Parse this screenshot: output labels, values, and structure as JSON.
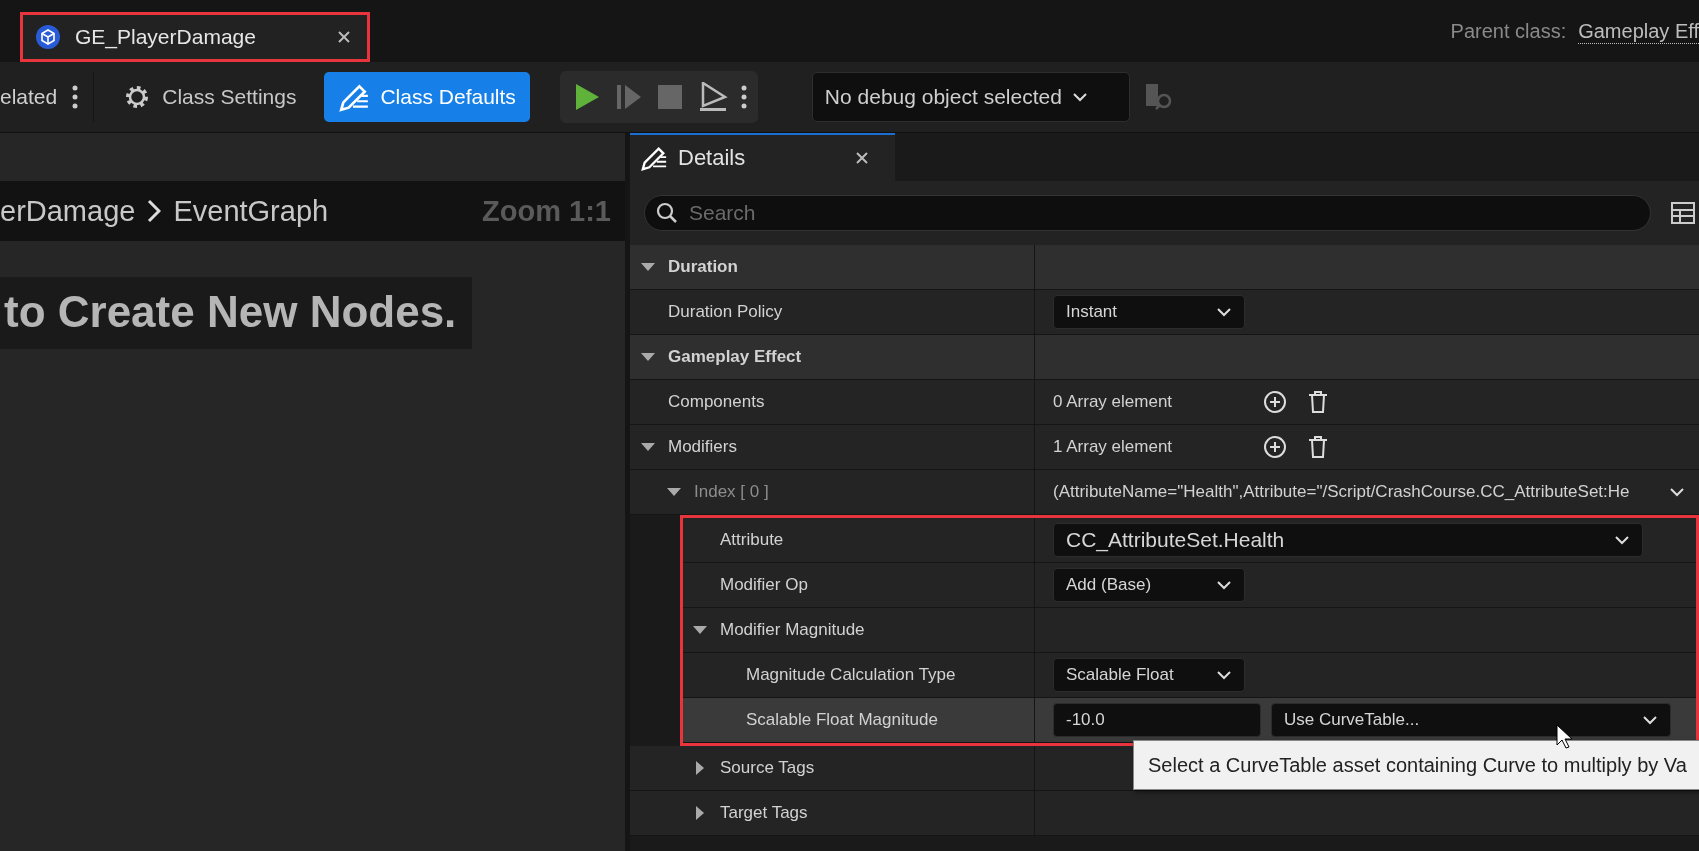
{
  "document_tab": {
    "title": "GE_PlayerDamage",
    "highlighted": true
  },
  "parent_class": {
    "label": "Parent class:",
    "value": "Gameplay Eff"
  },
  "toolbar": {
    "related_label": "elated",
    "buttons": [
      {
        "label": "Class Settings",
        "kind": "settings",
        "selected": false
      },
      {
        "label": "Class Defaults",
        "kind": "defaults",
        "selected": true
      }
    ],
    "debug_select": "No debug object selected"
  },
  "graph": {
    "breadcrumb": [
      "erDamage",
      "EventGraph"
    ],
    "zoom": "Zoom 1:1",
    "hint": "to Create New Nodes."
  },
  "details": {
    "title": "Details",
    "search_placeholder": "Search",
    "rows": [
      {
        "kind": "category",
        "label": "Duration",
        "expanded": true,
        "children": [
          {
            "kind": "dropdown",
            "label": "Duration Policy",
            "value": "Instant"
          }
        ]
      },
      {
        "kind": "category",
        "label": "Gameplay Effect",
        "expanded": true,
        "children": [
          {
            "kind": "array",
            "label": "Components",
            "value": "0 Array element"
          },
          {
            "kind": "array",
            "label": "Modifiers",
            "value": "1 Array element",
            "expanded": true,
            "children": [
              {
                "kind": "struct",
                "label": "Index [ 0 ]",
                "value": "(AttributeName=\"Health\",Attribute=\"/Script/CrashCourse.CC_AttributeSet:He",
                "expanded": true,
                "children": [
                  {
                    "kind": "wide_dropdown",
                    "label": "Attribute",
                    "value": "CC_AttributeSet.Health",
                    "highlighted": true
                  },
                  {
                    "kind": "dropdown",
                    "label": "Modifier Op",
                    "value": "Add (Base)",
                    "highlighted": true
                  },
                  {
                    "kind": "group",
                    "label": "Modifier Magnitude",
                    "expanded": true,
                    "highlighted": true,
                    "children": [
                      {
                        "kind": "dropdown",
                        "label": "Magnitude Calculation Type",
                        "value": "Scalable Float",
                        "highlighted": true
                      },
                      {
                        "kind": "float_curve",
                        "label": "Scalable Float Magnitude",
                        "value": "-10.0",
                        "curve": "Use CurveTable...",
                        "hovered": true,
                        "highlighted": true
                      }
                    ]
                  },
                  {
                    "kind": "group",
                    "label": "Source Tags",
                    "expanded": false
                  },
                  {
                    "kind": "group",
                    "label": "Target Tags",
                    "expanded": false
                  }
                ]
              }
            ]
          }
        ]
      }
    ]
  },
  "tooltip": "Select a CurveTable asset containing Curve to multiply by Va"
}
